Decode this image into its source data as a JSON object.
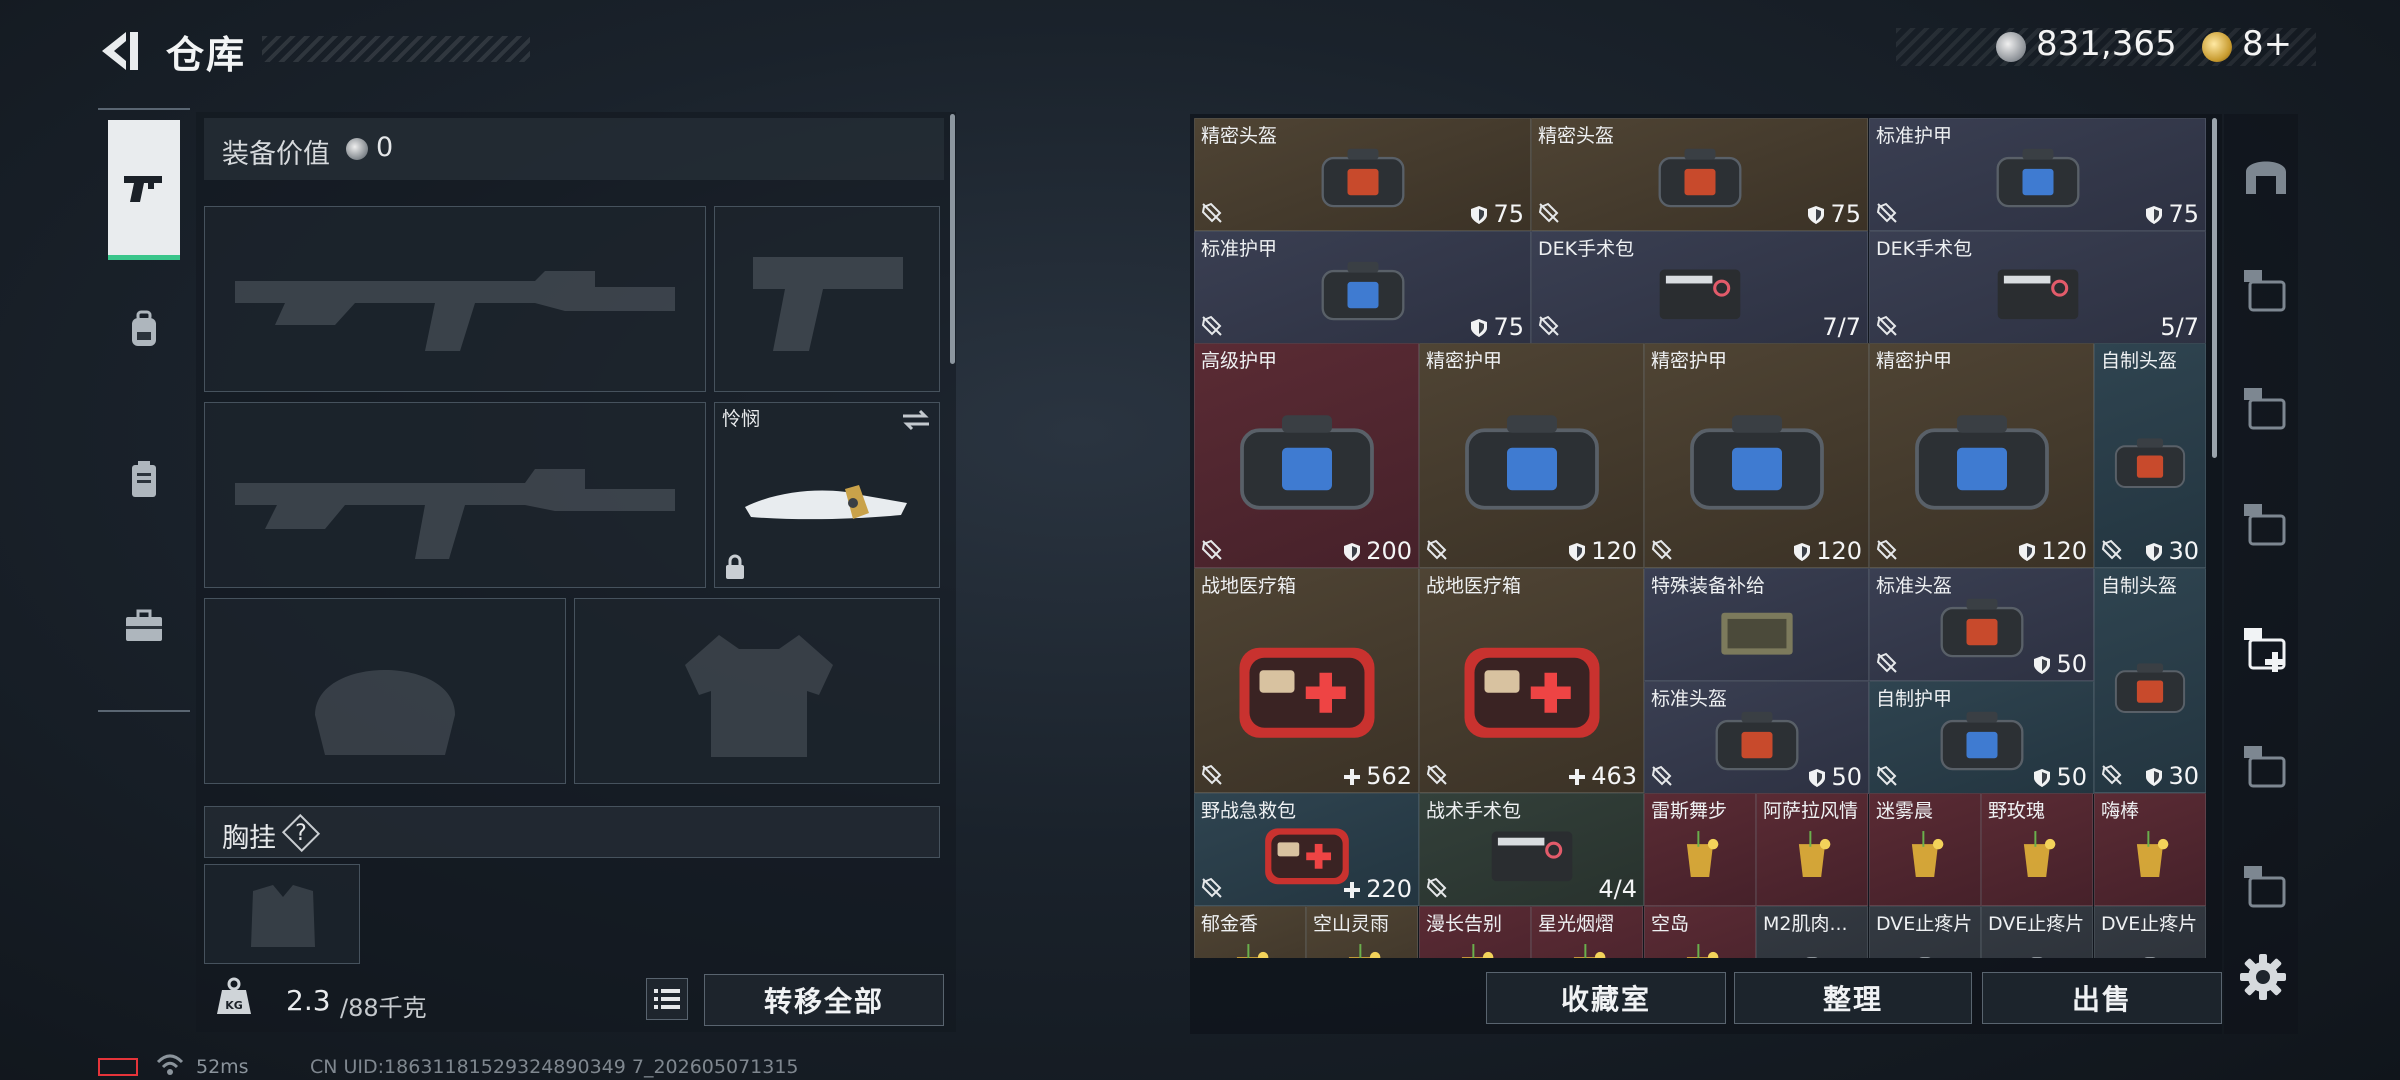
{
  "header": {
    "title": "仓库"
  },
  "currency": {
    "money": "831,365",
    "tickets": "8+"
  },
  "equip": {
    "value_label": "装备价值",
    "value": "0",
    "melee_name": "怜悯",
    "chest_label": "胸挂",
    "chest_help": "?",
    "weight": "2.3",
    "weight_unit": "/88千克",
    "transfer_label": "转移全部"
  },
  "left_tabs": [
    "gun-icon",
    "backpack-icon",
    "armor-icon",
    "briefcase-icon"
  ],
  "inventory": {
    "items": [
      {
        "name": "精密头盔",
        "value": "75",
        "kind": "shield",
        "color": "brown"
      },
      {
        "name": "精密头盔",
        "value": "75",
        "kind": "shield",
        "color": "brown"
      },
      {
        "name": "标准护甲",
        "value": "75",
        "kind": "shield",
        "color": "blue"
      },
      {
        "name": "标准护甲",
        "value": "75",
        "kind": "shield",
        "color": "blue"
      },
      {
        "name": "DEK手术包",
        "value": "7/7",
        "kind": "count",
        "color": "blue"
      },
      {
        "name": "DEK手术包",
        "value": "5/7",
        "kind": "count",
        "color": "blue"
      },
      {
        "name": "高级护甲",
        "value": "200",
        "kind": "shield",
        "color": "red"
      },
      {
        "name": "精密护甲",
        "value": "120",
        "kind": "shield",
        "color": "brown"
      },
      {
        "name": "精密护甲",
        "value": "120",
        "kind": "shield",
        "color": "brown"
      },
      {
        "name": "精密护甲",
        "value": "120",
        "kind": "shield",
        "color": "brown"
      },
      {
        "name": "自制头盔",
        "value": "30",
        "kind": "shield",
        "color": "teal"
      },
      {
        "name": "战地医疗箱",
        "value": "562",
        "kind": "plus",
        "color": "brown"
      },
      {
        "name": "战地医疗箱",
        "value": "463",
        "kind": "plus",
        "color": "brown"
      },
      {
        "name": "特殊装备补给",
        "value": "",
        "kind": "none",
        "color": "blue"
      },
      {
        "name": "标准头盔",
        "value": "50",
        "kind": "shield",
        "color": "blue"
      },
      {
        "name": "自制头盔",
        "value": "30",
        "kind": "shield",
        "color": "teal"
      },
      {
        "name": "标准头盔",
        "value": "50",
        "kind": "shield",
        "color": "blue"
      },
      {
        "name": "自制护甲",
        "value": "50",
        "kind": "shield",
        "color": "teal"
      },
      {
        "name": "野战急救包",
        "value": "220",
        "kind": "plus",
        "color": "teal"
      },
      {
        "name": "战术手术包",
        "value": "4/4",
        "kind": "count",
        "color": "green"
      },
      {
        "name": "雷斯舞步",
        "value": "",
        "kind": "none",
        "color": "red"
      },
      {
        "name": "阿萨拉风情",
        "value": "",
        "kind": "none",
        "color": "red"
      },
      {
        "name": "迷雾晨",
        "value": "",
        "kind": "none",
        "color": "red"
      },
      {
        "name": "野玫瑰",
        "value": "",
        "kind": "none",
        "color": "red"
      },
      {
        "name": "嗨棒",
        "value": "",
        "kind": "none",
        "color": "red"
      },
      {
        "name": "郁金香",
        "value": "",
        "kind": "none",
        "color": "brown"
      },
      {
        "name": "空山灵雨",
        "value": "",
        "kind": "none",
        "color": "brown"
      },
      {
        "name": "漫长告别",
        "value": "",
        "kind": "none",
        "color": "red"
      },
      {
        "name": "星光烟熠",
        "value": "",
        "kind": "none",
        "color": "red"
      },
      {
        "name": "空岛",
        "value": "",
        "kind": "none",
        "color": "red"
      },
      {
        "name": "M2肌肉...",
        "value": "",
        "kind": "none",
        "color": "gray"
      },
      {
        "name": "DVE止疼片",
        "value": "",
        "kind": "none",
        "color": "gray"
      },
      {
        "name": "DVE止疼片",
        "value": "",
        "kind": "none",
        "color": "gray"
      },
      {
        "name": "DVE止疼片",
        "value": "",
        "kind": "none",
        "color": "gray"
      }
    ]
  },
  "right_tabs": [
    "helmet-tab-icon",
    "tier4-warehouse-tab-icon",
    "tier5-warehouse-tab-icon",
    "tier4-ammo-tab-icon",
    "tier4-medical-tab-icon",
    "tier4-gear-tab-icon",
    "gt-tab-icon"
  ],
  "actions": {
    "collect": "收藏室",
    "organize": "整理",
    "sell": "出售"
  },
  "status": {
    "ping": "52ms",
    "uid": "CN UID:18631181529324890349 7_202605071315"
  },
  "colors": {
    "accent_green": "#39c58a",
    "battery_red": "#e5343a"
  }
}
